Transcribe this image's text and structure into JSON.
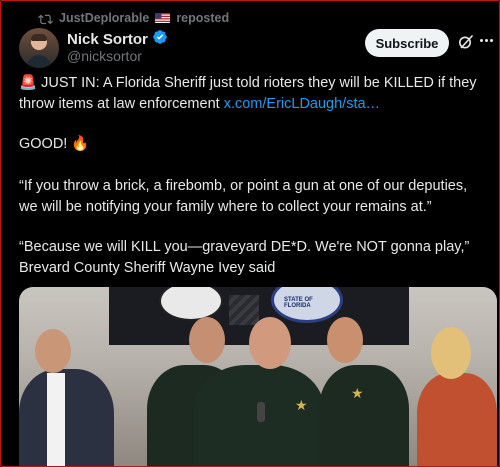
{
  "repost": {
    "user": "JustDeplorable",
    "action": "reposted",
    "icons": [
      "repost-icon",
      "us-flag-icon"
    ]
  },
  "author": {
    "name": "Nick Sortor",
    "handle": "@nicksortor",
    "verified_color": "#1d9bf0"
  },
  "actions": {
    "subscribe_label": "Subscribe",
    "icons": [
      "grok-icon",
      "more-icon"
    ]
  },
  "post": {
    "p1_emoji": "🚨",
    "p1_text": " JUST IN: A Florida Sheriff just told rioters they will be KILLED if they throw items at law enforcement ",
    "p1_link": "x.com/EricLDaugh/sta…",
    "p2_text": "GOOD! ",
    "p2_emoji": "🔥",
    "p3_text": "“If you throw a brick, a firebomb, or point a gun at one of our deputies, we will be notifying your family where to collect your remains at.”",
    "p4_text": "“Because we will KILL you—graveyard DE*D. We're NOT gonna play,” Brevard County Sheriff Wayne Ivey said"
  },
  "media": {
    "seal_text": "STATE OF FLORIDA",
    "colors": {
      "link": "#1d9bf0",
      "frame": "#c21313"
    }
  }
}
